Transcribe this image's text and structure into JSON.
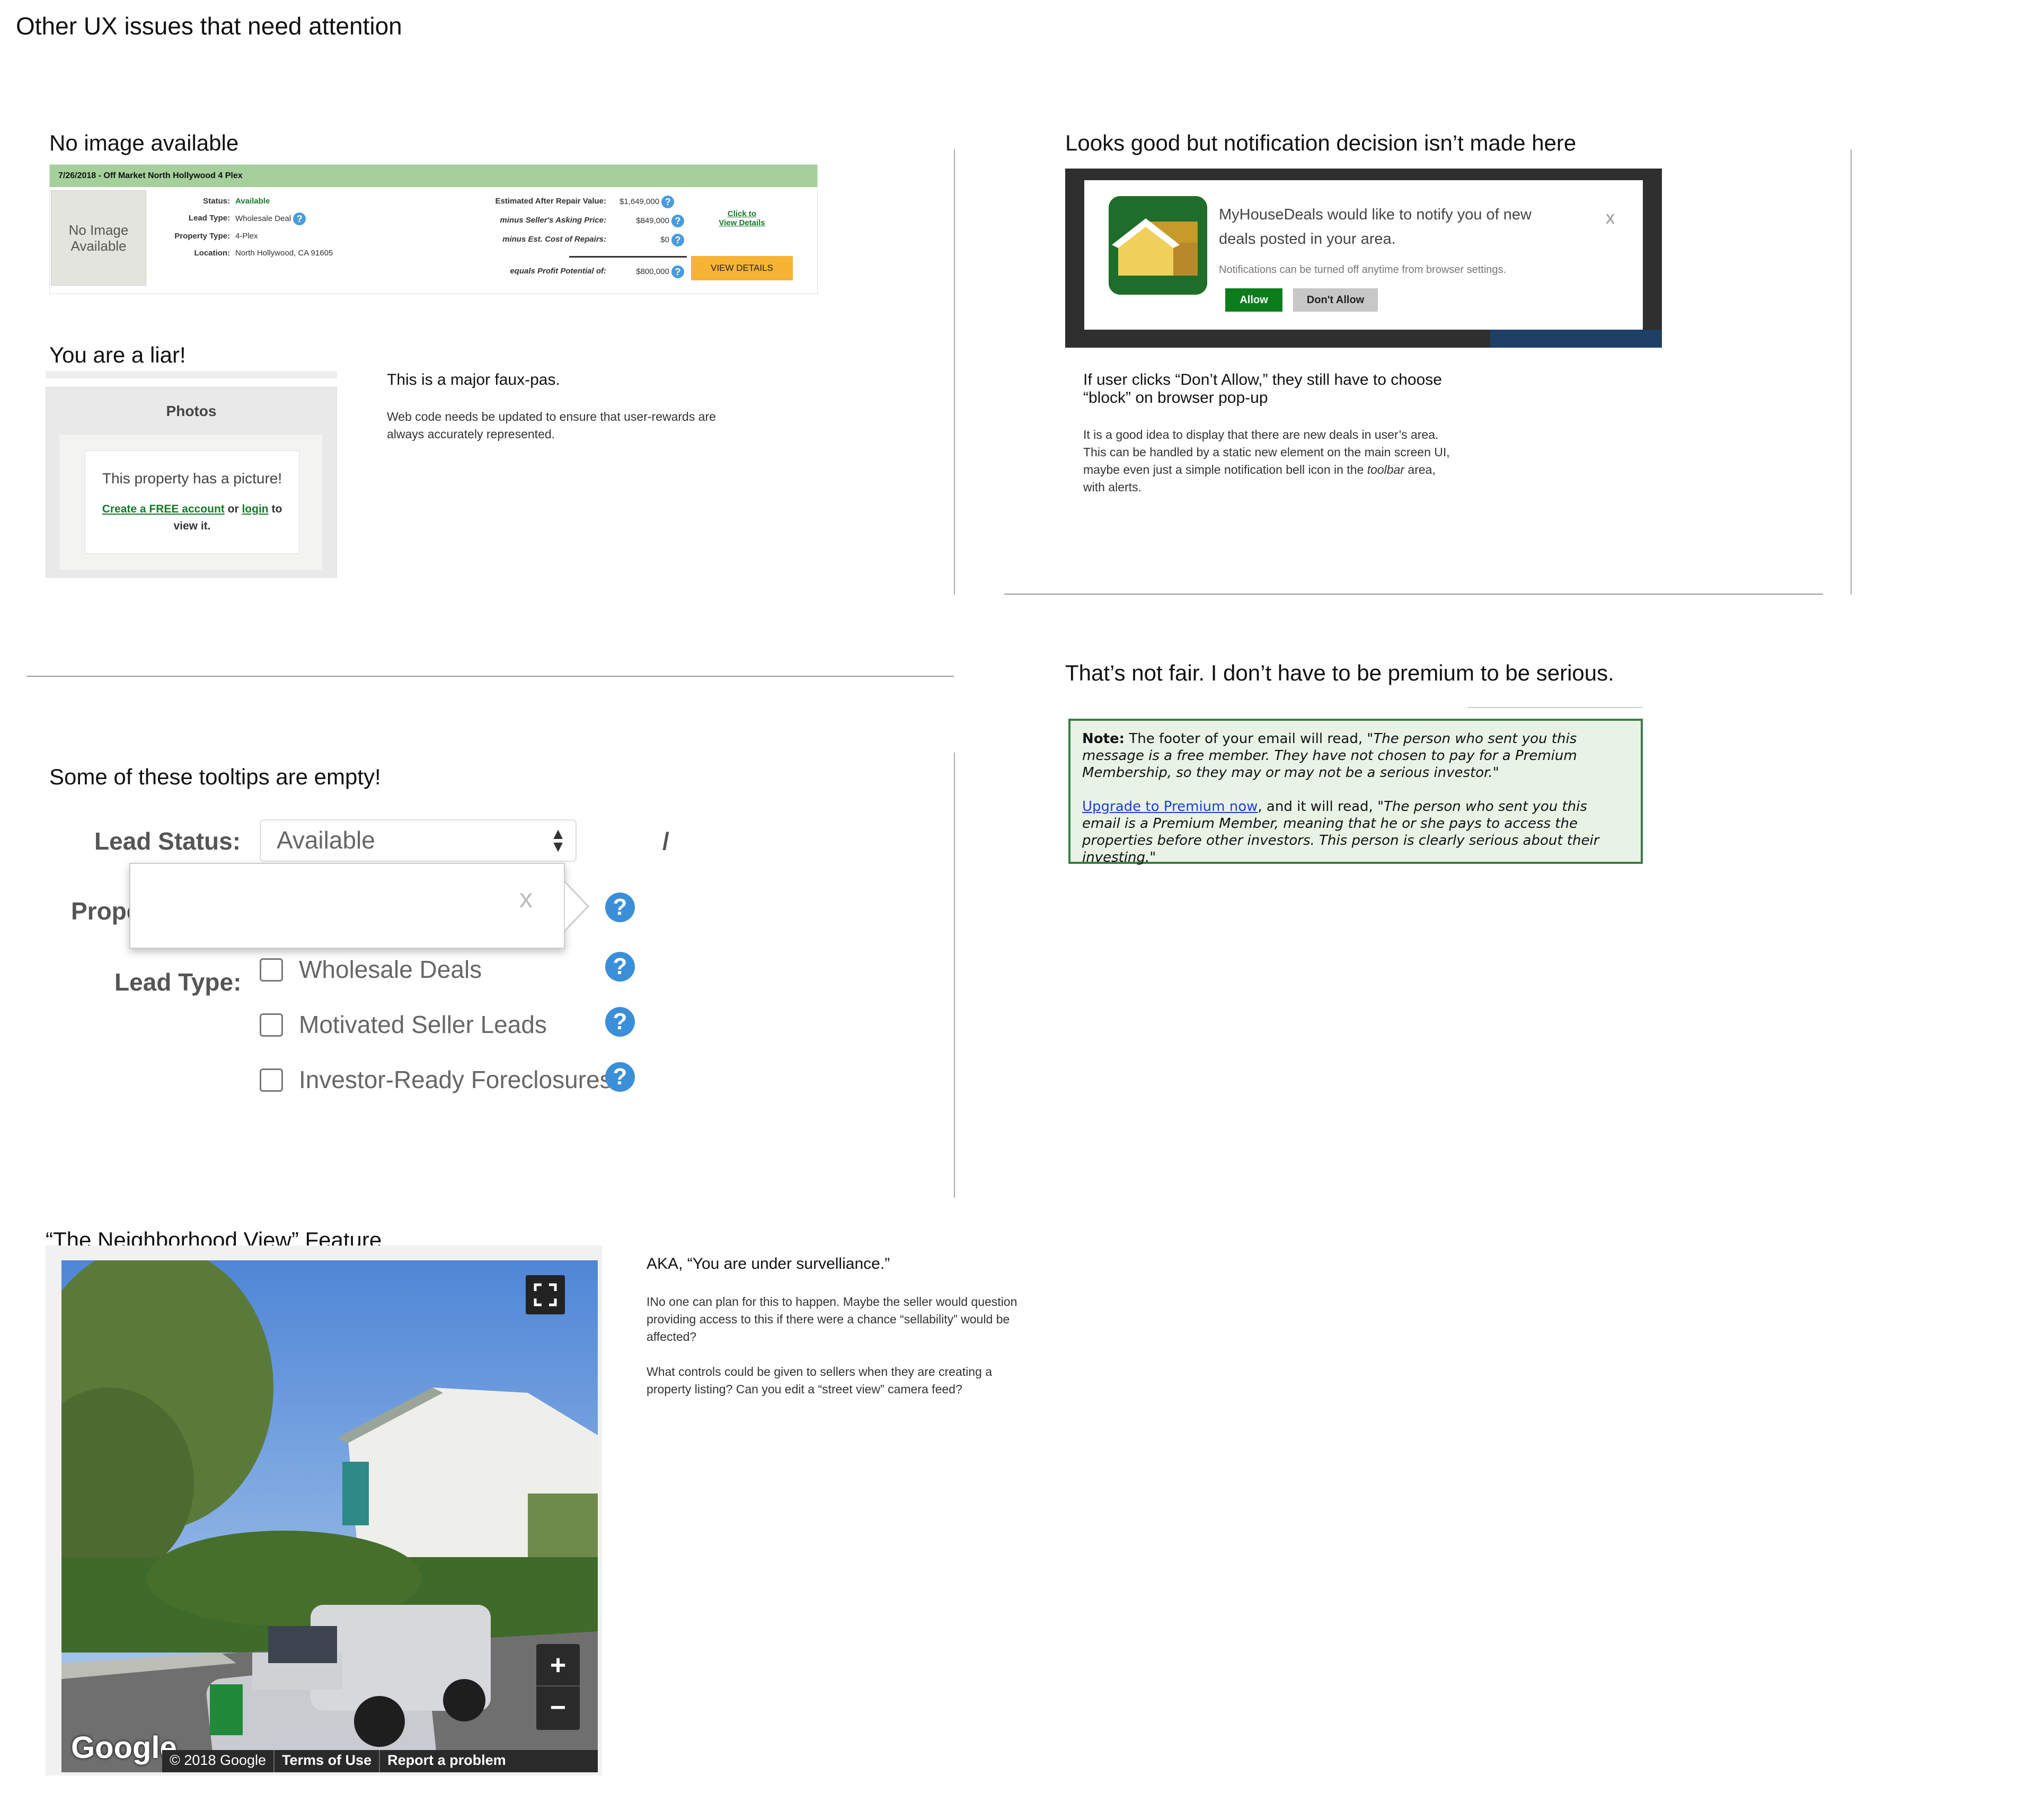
{
  "page_title": "Other UX issues that need attention",
  "sections": {
    "no_image": {
      "heading": "No image available",
      "listing": {
        "bar_text": "7/26/2018 - Off Market North Hollywood 4 Plex",
        "no_image_text": "No Image Available",
        "status_label": "Status:",
        "status_value": "Available",
        "lead_type_label": "Lead Type:",
        "lead_type_value": "Wholesale Deal",
        "property_type_label": "Property Type:",
        "property_type_value": "4-Plex",
        "location_label": "Location:",
        "location_value": "North Hollywood, CA 91605",
        "arv_label": "Estimated After Repair Value:",
        "arv_value": "$1,649,000",
        "asking_label": "minus Seller's Asking Price:",
        "asking_value": "$849,000",
        "repairs_label": "minus Est. Cost of Repairs:",
        "repairs_value": "$0",
        "profit_label": "equals Profit Potential of:",
        "profit_value": "$800,000",
        "click_to": "Click to",
        "view_details_link": "View Details",
        "view_details_button": "VIEW DETAILS"
      }
    },
    "liar": {
      "heading": "You are a liar!",
      "photos_title": "Photos",
      "picture_msg": "This property has a picture!",
      "create_link": "Create a FREE account",
      "or_text": "or",
      "login_link": "login",
      "to_text": "to",
      "view_it": "view it.",
      "note_heading": "This is a major faux-pas.",
      "note_body": "Web code needs be updated to ensure that user-rewards are always accurately represented."
    },
    "notification": {
      "heading": "Looks good but notification decision isn’t made here",
      "message": "MyHouseDeals would like to notify you of new deals posted in your area.",
      "sub": "Notifications can be turned off anytime from browser settings.",
      "allow": "Allow",
      "dont_allow": "Don't Allow",
      "close": "x",
      "note_heading": "If user clicks “Don’t Allow,” they still have to choose “block” on browser pop-up",
      "note_body_1": "It is a good idea to display that there are new deals in user’s area. This can be handled by a static new element on the main screen UI, maybe even just a simple notification bell icon in the ",
      "note_body_em": "toolbar",
      "note_body_2": " area, with alerts."
    },
    "premium": {
      "heading": "That’s not fair. I don’t have to be premium to be serious.",
      "note_label": "Note:",
      "note_text": "The footer of your email will read, \"",
      "note_italic": "The person who sent you this message is a free member. They have not chosen to pay for a Premium Membership, so they may or may not be a serious investor.",
      "note_end": "\"",
      "upgrade_link": "Upgrade to Premium now",
      "upgrade_text": ", and it will read, \"",
      "upgrade_italic": "The person who sent you this email is a Premium Member, meaning that he or she pays to access the properties before other investors. This person is clearly serious about their investing.",
      "upgrade_end": "\""
    },
    "tooltips": {
      "heading": "Some of these tooltips are empty!",
      "lead_status_label": "Lead Status:",
      "lead_status_value": "Available",
      "property_label_partial": "Prope",
      "lead_type_label": "Lead Type:",
      "tooltip_close": "x",
      "options": [
        "Wholesale Deals",
        "Motivated Seller Leads",
        "Investor-Ready Foreclosures"
      ],
      "help": "?"
    },
    "neighborhood": {
      "heading": "“The Neighborhood View” Feature",
      "google": "Google",
      "copyright": "© 2018 Google",
      "terms": "Terms of Use",
      "report": "Report a problem",
      "zoom_in": "+",
      "zoom_out": "−",
      "note_heading": "AKA, “You are under survelliance.”",
      "note_p1": "INo one can plan for this to happen. Maybe the seller would question providing access to this if there were a chance “sellability” would be affected?",
      "note_p2": "What controls could be given to sellers when they are creating a property listing? Can you edit a “street view” camera feed?"
    }
  },
  "colors": {
    "green_bar": "#a5d09b",
    "allow_green": "#0d7d1c",
    "note_border": "#3a7d44",
    "help_blue": "#3b8ed8",
    "cta_orange": "#f6b334"
  }
}
